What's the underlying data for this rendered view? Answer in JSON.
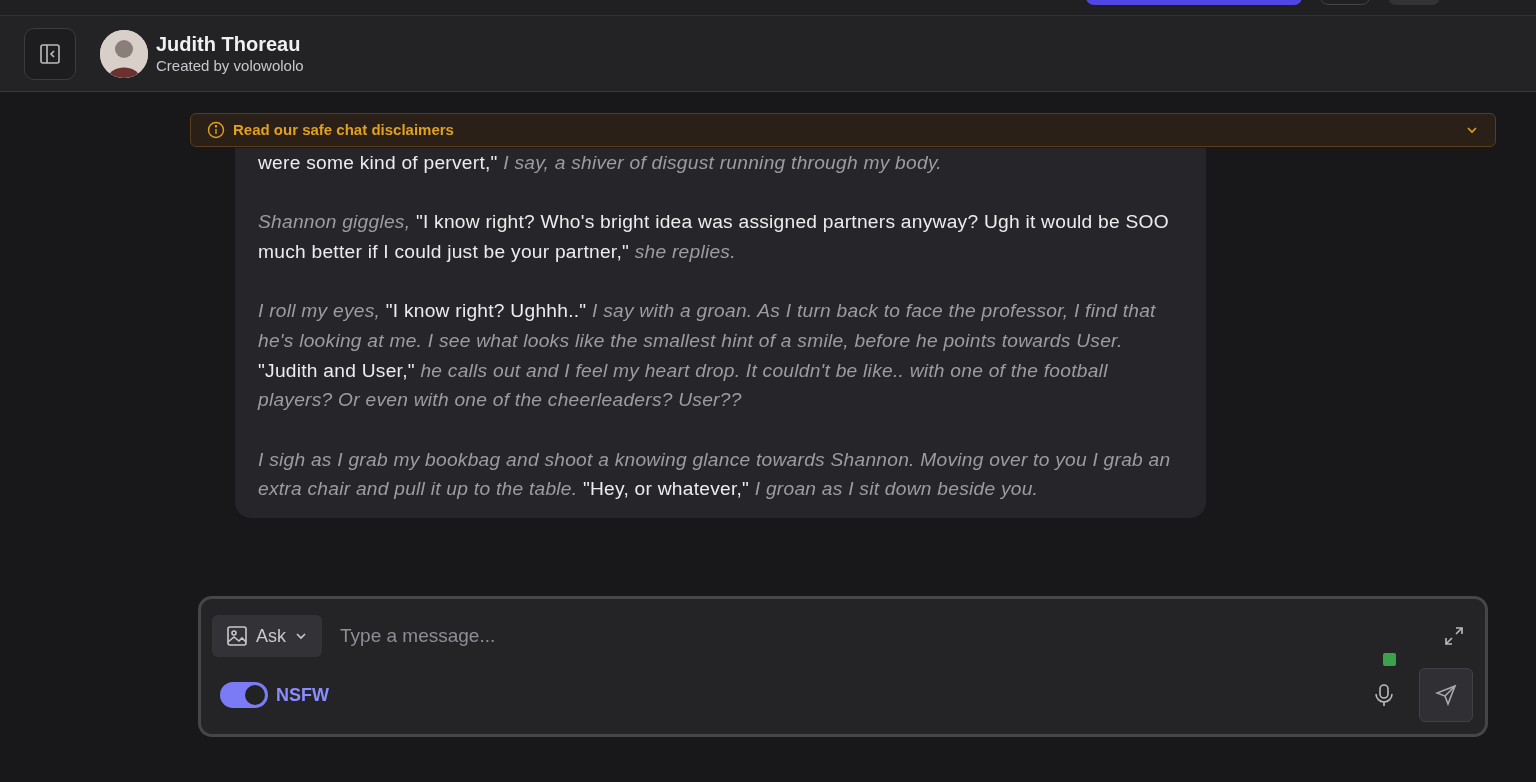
{
  "header": {
    "title": "Judith Thoreau",
    "subtitle": "Created by volowololo"
  },
  "disclaimer": {
    "text": "Read our safe chat disclaimers"
  },
  "message": {
    "paragraphs": [
      "were some kind of pervert,\" *I say, a shiver of disgust running through my body.*",
      "*Shannon giggles,* \"I know right? Who's bright idea was assigned partners anyway? Ugh it would be SOO much better if I could just be your partner,\" *she replies.*",
      "*I roll my eyes,* \"I know right? Ughhh..\" *I say with a groan. As I turn back to face the professor, I find that he's looking at me. I see what looks like the smallest hint of a smile, before he points towards User.* \"Judith and User,\" *he calls out and I feel my heart drop. It couldn't be like.. with one of the football players? Or even with one of the cheerleaders? User??*",
      "*I sigh as I grab my bookbag and shoot a knowing glance towards Shannon. Moving over to you I grab an extra chair and pull it up to the table.* \"Hey, or whatever,\" *I groan as I sit down beside you.*"
    ]
  },
  "composer": {
    "mode": "Ask",
    "placeholder": "Type a message...",
    "nsfw": {
      "label": "NSFW",
      "on": true
    }
  }
}
